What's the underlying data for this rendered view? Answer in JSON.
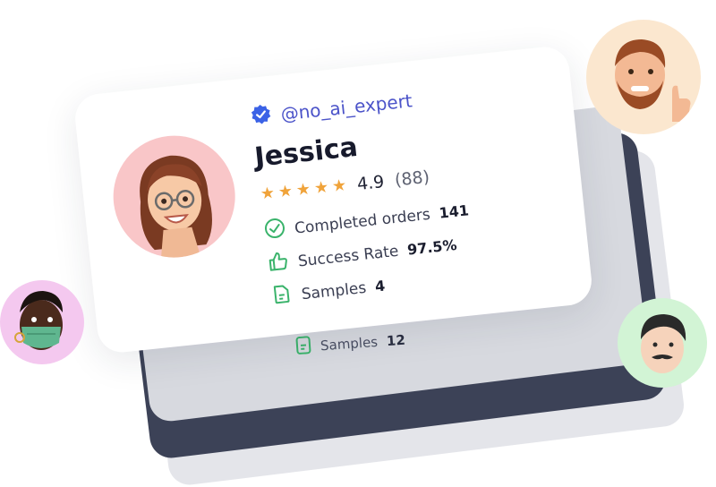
{
  "profile": {
    "handle": "@no_ai_expert",
    "name": "Jessica",
    "rating": "4.9",
    "rating_count": "(88)",
    "stars": 5,
    "stats": [
      {
        "label": "Completed orders",
        "value": "141",
        "icon": "check-circle-icon"
      },
      {
        "label": "Success Rate",
        "value": "97.5%",
        "icon": "thumbs-up-icon"
      },
      {
        "label": "Samples",
        "value": "4",
        "icon": "document-icon"
      }
    ]
  },
  "behind_card": {
    "samples_label": "Samples",
    "samples_value": "12"
  },
  "colors": {
    "accent": "#4b53c9",
    "star": "#f0a33a",
    "icon_green": "#3ab36b",
    "dark_card": "#3c4257"
  }
}
